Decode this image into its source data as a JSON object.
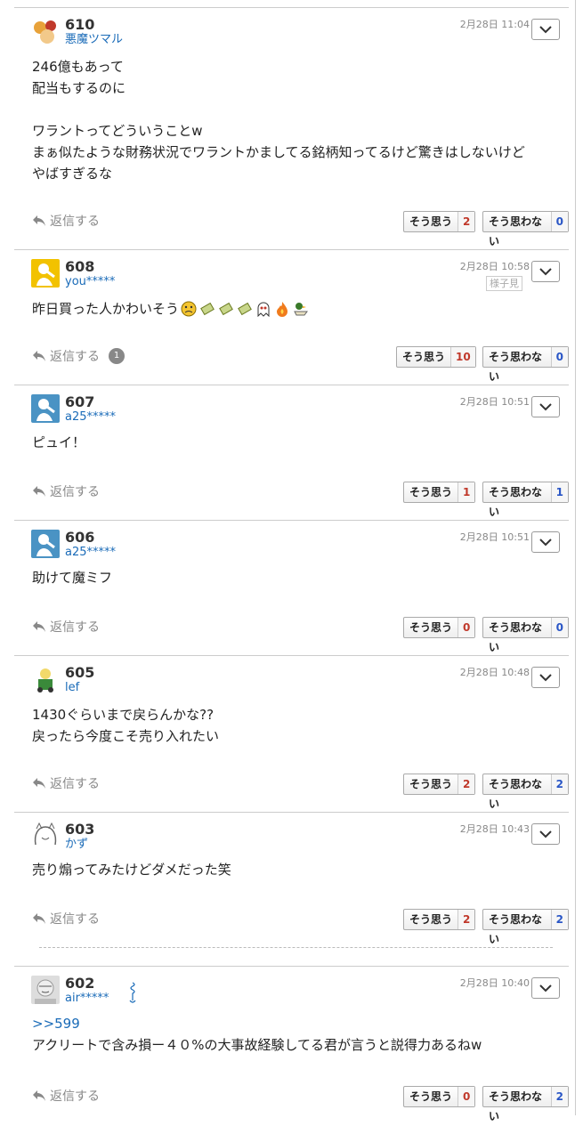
{
  "comments": [
    {
      "no": "610",
      "user": "悪魔ツマル",
      "date": "2月28日 11:04",
      "lines": [
        "246億もあって",
        "配当もするのに",
        "",
        "ワラントってどういうことw",
        "まぁ似たような財務状況でワラントかましてる銘柄知ってるけど驚きはしないけど",
        "やばすぎるな"
      ],
      "reply": "返信する",
      "agree_label": "そう思う",
      "agree": "2",
      "disagree_label": "そう思わない",
      "disagree": "0"
    },
    {
      "no": "608",
      "user": "you*****",
      "date": "2月28日 10:58",
      "state": "様子見",
      "lines": [
        "昨日買った人かわいそう"
      ],
      "reply": "返信する",
      "reply_count": "1",
      "agree_label": "そう思う",
      "agree": "10",
      "disagree_label": "そう思わない",
      "disagree": "0"
    },
    {
      "no": "607",
      "user": "a25*****",
      "date": "2月28日 10:51",
      "lines": [
        "ピュイ！"
      ],
      "reply": "返信する",
      "agree_label": "そう思う",
      "agree": "1",
      "disagree_label": "そう思わない",
      "disagree": "1"
    },
    {
      "no": "606",
      "user": "a25*****",
      "date": "2月28日 10:51",
      "lines": [
        "助けて魔ミフ"
      ],
      "reply": "返信する",
      "agree_label": "そう思う",
      "agree": "0",
      "disagree_label": "そう思わない",
      "disagree": "0"
    },
    {
      "no": "605",
      "user": "lef",
      "date": "2月28日 10:48",
      "lines": [
        "1430ぐらいまで戻らんかな??",
        "戻ったら今度こそ売り入れたい"
      ],
      "reply": "返信する",
      "agree_label": "そう思う",
      "agree": "2",
      "disagree_label": "そう思わない",
      "disagree": "2"
    },
    {
      "no": "603",
      "user": "かず",
      "date": "2月28日 10:43",
      "lines": [
        "売り煽ってみたけどダメだった笑"
      ],
      "reply": "返信する",
      "agree_label": "そう思う",
      "agree": "2",
      "disagree_label": "そう思わない",
      "disagree": "2"
    },
    {
      "no": "602",
      "user": "air*****",
      "date": "2月28日 10:40",
      "link": ">>599",
      "lines": [
        "アクリートで含み損ー４０%の大事故経験してる君が言うと説得力あるねw"
      ],
      "reply": "返信する",
      "agree_label": "そう思う",
      "agree": "0",
      "disagree_label": "そう思わない",
      "disagree": "2"
    }
  ],
  "colors": {
    "username": "#1a6bb8",
    "agree_count": "#c0392b",
    "disagree_count": "#2a56c6"
  },
  "icons": [
    "reply-arrow-icon",
    "chevron-down-icon",
    "avatar"
  ]
}
